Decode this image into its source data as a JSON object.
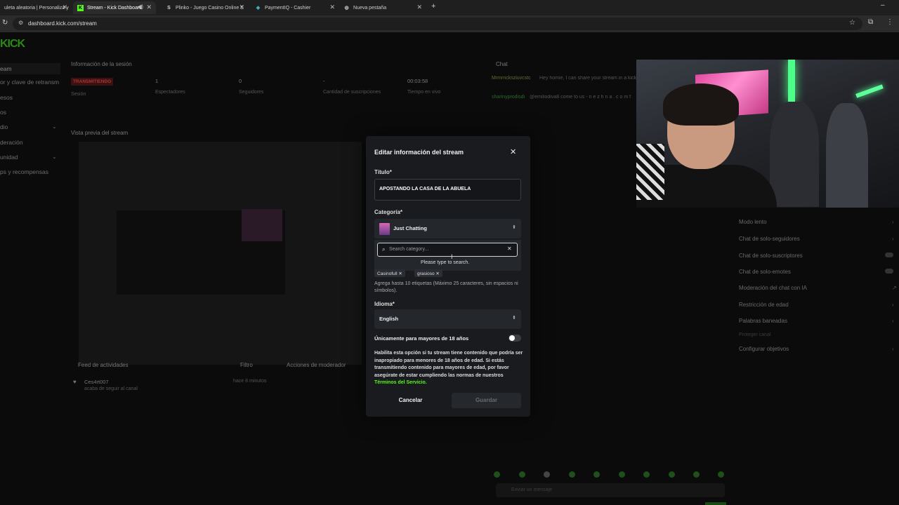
{
  "browser": {
    "tabs": [
      {
        "label": "uleta aleatoria | Personaliza y"
      },
      {
        "label": "Stream - Kick Dashboard"
      },
      {
        "label": "Plinko - Juego Casino Online S"
      },
      {
        "label": "PaymentIQ - Cashier"
      },
      {
        "label": "Nueva pestaña"
      }
    ],
    "new_tab": "+",
    "url": "dashboard.kick.com/stream"
  },
  "dashboard": {
    "logo": "KICK",
    "sidebar": [
      {
        "label": "eam"
      },
      {
        "label": "or y clave de retransm"
      },
      {
        "label": "esos"
      },
      {
        "label": "os"
      },
      {
        "label": "dio"
      },
      {
        "label": "deración"
      },
      {
        "label": "unidad"
      },
      {
        "label": "ps y recompensas"
      }
    ],
    "session": {
      "title": "Información de la sesión",
      "status": "TRANSMITIENDO",
      "status_label": "Sesión",
      "viewers": "1",
      "viewers_label": "Espectadores",
      "followers": "0",
      "followers_label": "Seguidores",
      "subs": "-",
      "subs_label": "Cantidad de suscripciones",
      "time": "00:03:58",
      "time_label": "Tiempo en vivo"
    },
    "preview_title": "Vista previa del stream",
    "activity": {
      "title": "Feed de actividades",
      "filter": "Filtro",
      "item_user": "Ces4rt007",
      "item_text": "acaba de seguir al canal",
      "item_time": "hace 8 minutos"
    },
    "mod_actions_title": "Acciones de moderador",
    "chat": {
      "title": "Chat",
      "msg1_user": "Mrmrncksziuvcstc",
      "msg1_text": "Hey homie, I can share your stream in a kick and 800 viewers and also earn $1,500 per stream, add me o",
      "msg2_user": "sharinyprodisdi",
      "msg2_text": "@emiliodiva8 come to us - n e z h n a . c o m f",
      "input_placeholder": "Enviar un mensaje"
    },
    "chat_settings": [
      {
        "label": "Modo lento"
      },
      {
        "label": "Chat de solo-seguidores"
      },
      {
        "label": "Chat de solo-suscriptores"
      },
      {
        "label": "Chat de solo-emotes"
      },
      {
        "label": "Moderación del chat con IA"
      },
      {
        "label": "Restricción de edad"
      },
      {
        "label": "Palabras baneadas"
      },
      {
        "label": "Proteger canal"
      },
      {
        "label": "Configurar objetivos"
      }
    ]
  },
  "modal": {
    "title": "Editar información del stream",
    "title_label": "Título*",
    "title_value": "APOSTANDO LA CASA DE LA ABUELA",
    "category_label": "Categoría*",
    "category_value": "Just Chatting",
    "search_placeholder": "Search category...",
    "search_hint": "Please type to search.",
    "tags": [
      "Casinofull",
      "grasioso"
    ],
    "tags_help": "Agrega hasta 10 etiquetas (Máximo 25 caracteres, sin espacios ni símbolos).",
    "language_label": "Idioma*",
    "language_value": "English",
    "adult_label": "Únicamente para mayores de 18 años",
    "adult_enabled": false,
    "adult_warning": "Habilita esta opción si tu stream tiene contenido que podría ser inapropiado para menores de 18 años de edad. Si estás transmitiendo contenido para mayores de edad, por favor asegúrate de estar cumpliendo las normas de nuestros",
    "terms_link": "Términos del Servicio.",
    "cancel_label": "Cancelar",
    "save_label": "Guardar"
  },
  "colors": {
    "brand": "#53fc18",
    "modal_bg": "#191b1f",
    "page_bg": "#0b0b0b"
  }
}
